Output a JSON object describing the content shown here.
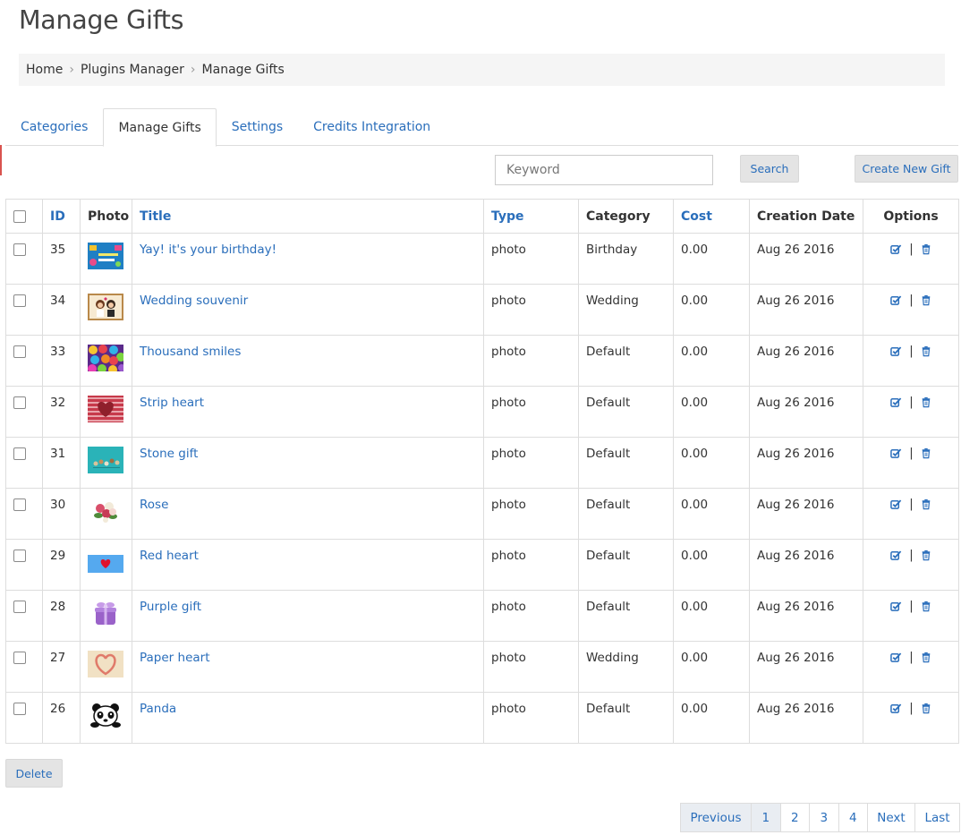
{
  "page": {
    "title": "Manage Gifts"
  },
  "breadcrumb": [
    "Home",
    "Plugins Manager",
    "Manage Gifts"
  ],
  "tabs": [
    {
      "label": "Categories",
      "active": false
    },
    {
      "label": "Manage Gifts",
      "active": true
    },
    {
      "label": "Settings",
      "active": false
    },
    {
      "label": "Credits Integration",
      "active": false
    }
  ],
  "search": {
    "placeholder": "Keyword",
    "button_label": "Search"
  },
  "create_button_label": "Create New Gift",
  "table": {
    "headers": {
      "id": "ID",
      "photo": "Photo",
      "title": "Title",
      "type": "Type",
      "category": "Category",
      "cost": "Cost",
      "creation_date": "Creation Date",
      "options": "Options"
    },
    "rows": [
      {
        "id": "35",
        "photo_icon": "birthday-card-thumbnail",
        "title": "Yay! it's your birthday!",
        "type": "photo",
        "category": "Birthday",
        "cost": "0.00",
        "date": "Aug 26 2016"
      },
      {
        "id": "34",
        "photo_icon": "wedding-couple-thumbnail",
        "title": "Wedding souvenir",
        "type": "photo",
        "category": "Wedding",
        "cost": "0.00",
        "date": "Aug 26 2016"
      },
      {
        "id": "33",
        "photo_icon": "colorful-smiles-thumbnail",
        "title": "Thousand smiles",
        "type": "photo",
        "category": "Default",
        "cost": "0.00",
        "date": "Aug 26 2016"
      },
      {
        "id": "32",
        "photo_icon": "striped-heart-thumbnail",
        "title": "Strip heart",
        "type": "photo",
        "category": "Default",
        "cost": "0.00",
        "date": "Aug 26 2016"
      },
      {
        "id": "31",
        "photo_icon": "stone-gift-thumbnail",
        "title": "Stone gift",
        "type": "photo",
        "category": "Default",
        "cost": "0.00",
        "date": "Aug 26 2016"
      },
      {
        "id": "30",
        "photo_icon": "rose-bouquet-thumbnail",
        "title": "Rose",
        "type": "photo",
        "category": "Default",
        "cost": "0.00",
        "date": "Aug 26 2016"
      },
      {
        "id": "29",
        "photo_icon": "red-heart-thumbnail",
        "title": "Red heart",
        "type": "photo",
        "category": "Default",
        "cost": "0.00",
        "date": "Aug 26 2016"
      },
      {
        "id": "28",
        "photo_icon": "purple-gift-box-thumbnail",
        "title": "Purple gift",
        "type": "photo",
        "category": "Default",
        "cost": "0.00",
        "date": "Aug 26 2016"
      },
      {
        "id": "27",
        "photo_icon": "paper-heart-thumbnail",
        "title": "Paper heart",
        "type": "photo",
        "category": "Wedding",
        "cost": "0.00",
        "date": "Aug 26 2016"
      },
      {
        "id": "26",
        "photo_icon": "panda-thumbnail",
        "title": "Panda",
        "type": "photo",
        "category": "Default",
        "cost": "0.00",
        "date": "Aug 26 2016"
      }
    ],
    "option_separator": "|"
  },
  "delete_button_label": "Delete",
  "pagination": {
    "previous": "Previous",
    "pages": [
      "1",
      "2",
      "3",
      "4"
    ],
    "current": "1",
    "next": "Next",
    "last": "Last"
  },
  "colors": {
    "link": "#2a6ebb",
    "breadcrumb_bg": "#f5f5f5",
    "button_bg": "#e4e4e4",
    "border": "#dddddd"
  }
}
